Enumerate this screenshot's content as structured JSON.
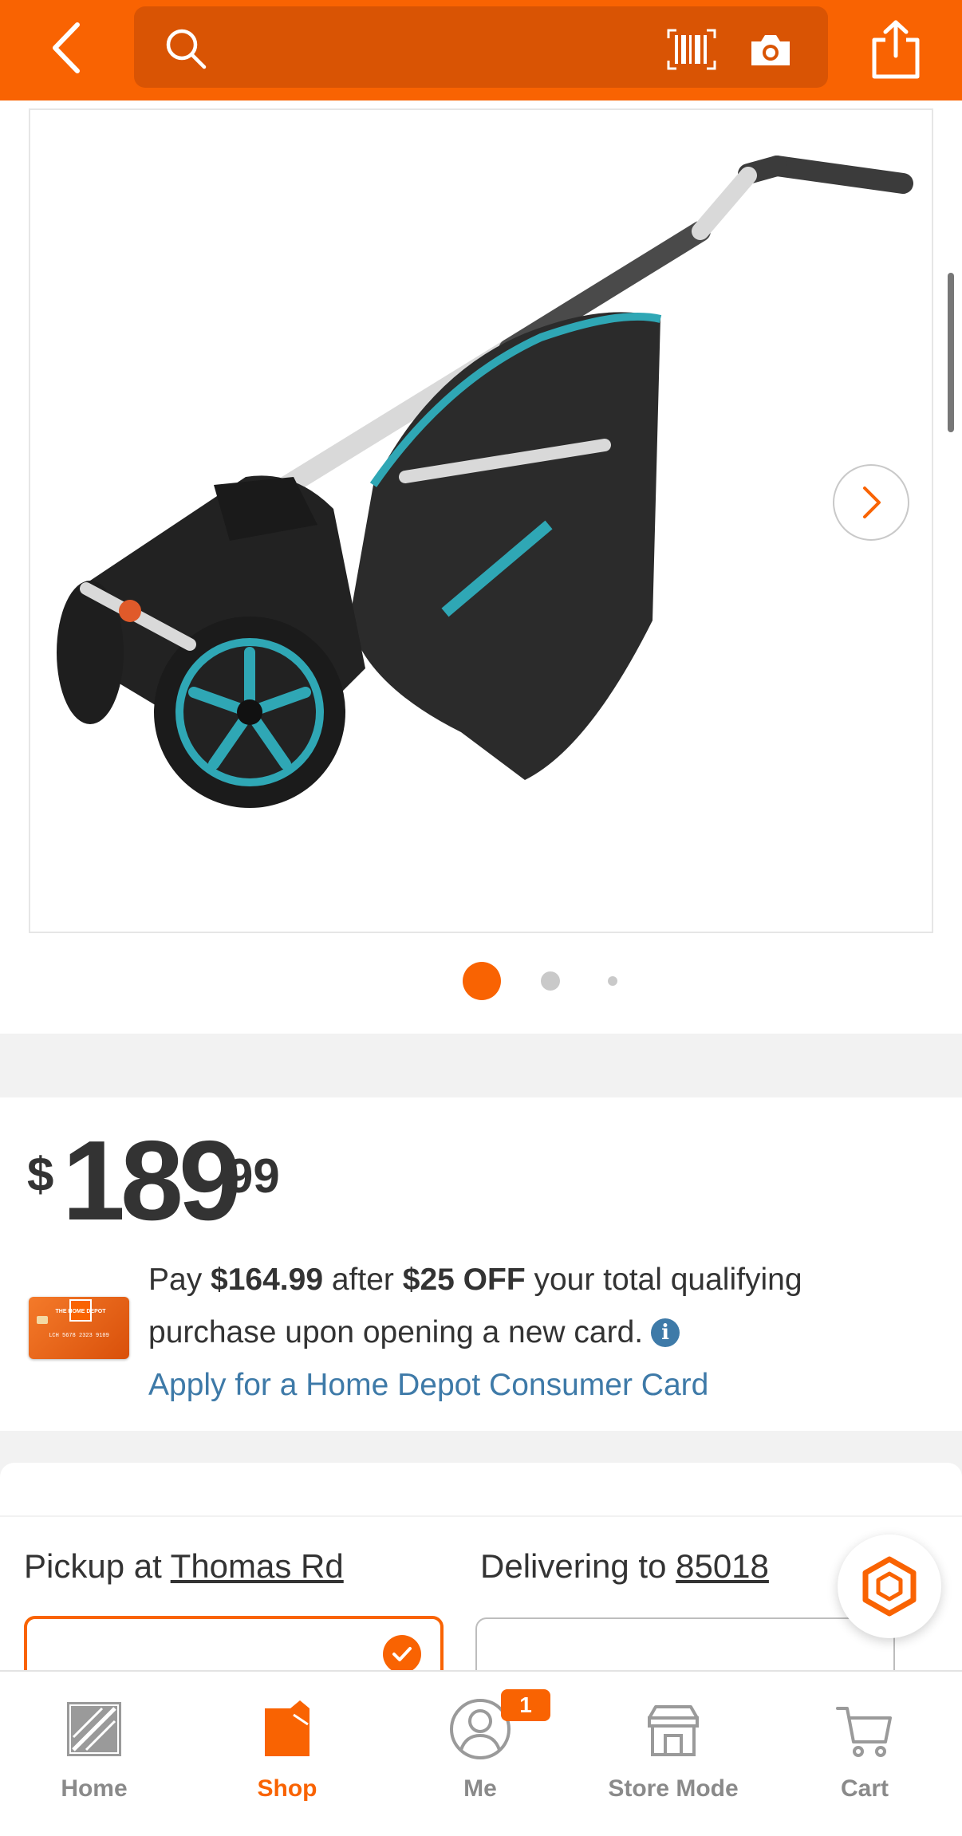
{
  "header": {
    "back_icon": "chevron-left-icon",
    "search": {
      "placeholder": "",
      "icon": "search-icon"
    },
    "barcode_icon": "barcode-scan-icon",
    "camera_icon": "camera-icon",
    "share_icon": "share-icon",
    "accent_color": "#f96302"
  },
  "media": {
    "image_alt": "",
    "next_icon": "chevron-right-icon",
    "pagination": {
      "total": 3,
      "active": 1
    }
  },
  "price": {
    "currency": "$",
    "dollars": "189",
    "cents": "99"
  },
  "promo": {
    "line_pre": "Pay ",
    "amount": "$164.99",
    "line_mid": " after ",
    "discount": "$25 OFF",
    "line_post": " your total qualifying purchase upon opening a new card.",
    "link": "Apply for a Home Depot Consumer Card",
    "card_number": "LCH 5678 2323 9109",
    "card_logo": "THE HOME DEPOT"
  },
  "fulfillment": {
    "pickup_prefix": "Pickup at ",
    "pickup_store": "Thomas Rd",
    "delivery_prefix": "Delivering to ",
    "delivery_zip": "85018"
  },
  "bottom_nav": {
    "items": [
      {
        "label": "Home",
        "icon": "home-depot-logo-icon"
      },
      {
        "label": "Shop",
        "icon": "shop-bag-icon"
      },
      {
        "label": "Me",
        "icon": "user-icon",
        "badge": "1"
      },
      {
        "label": "Store Mode",
        "icon": "store-icon"
      },
      {
        "label": "Cart",
        "icon": "cart-icon"
      }
    ]
  }
}
